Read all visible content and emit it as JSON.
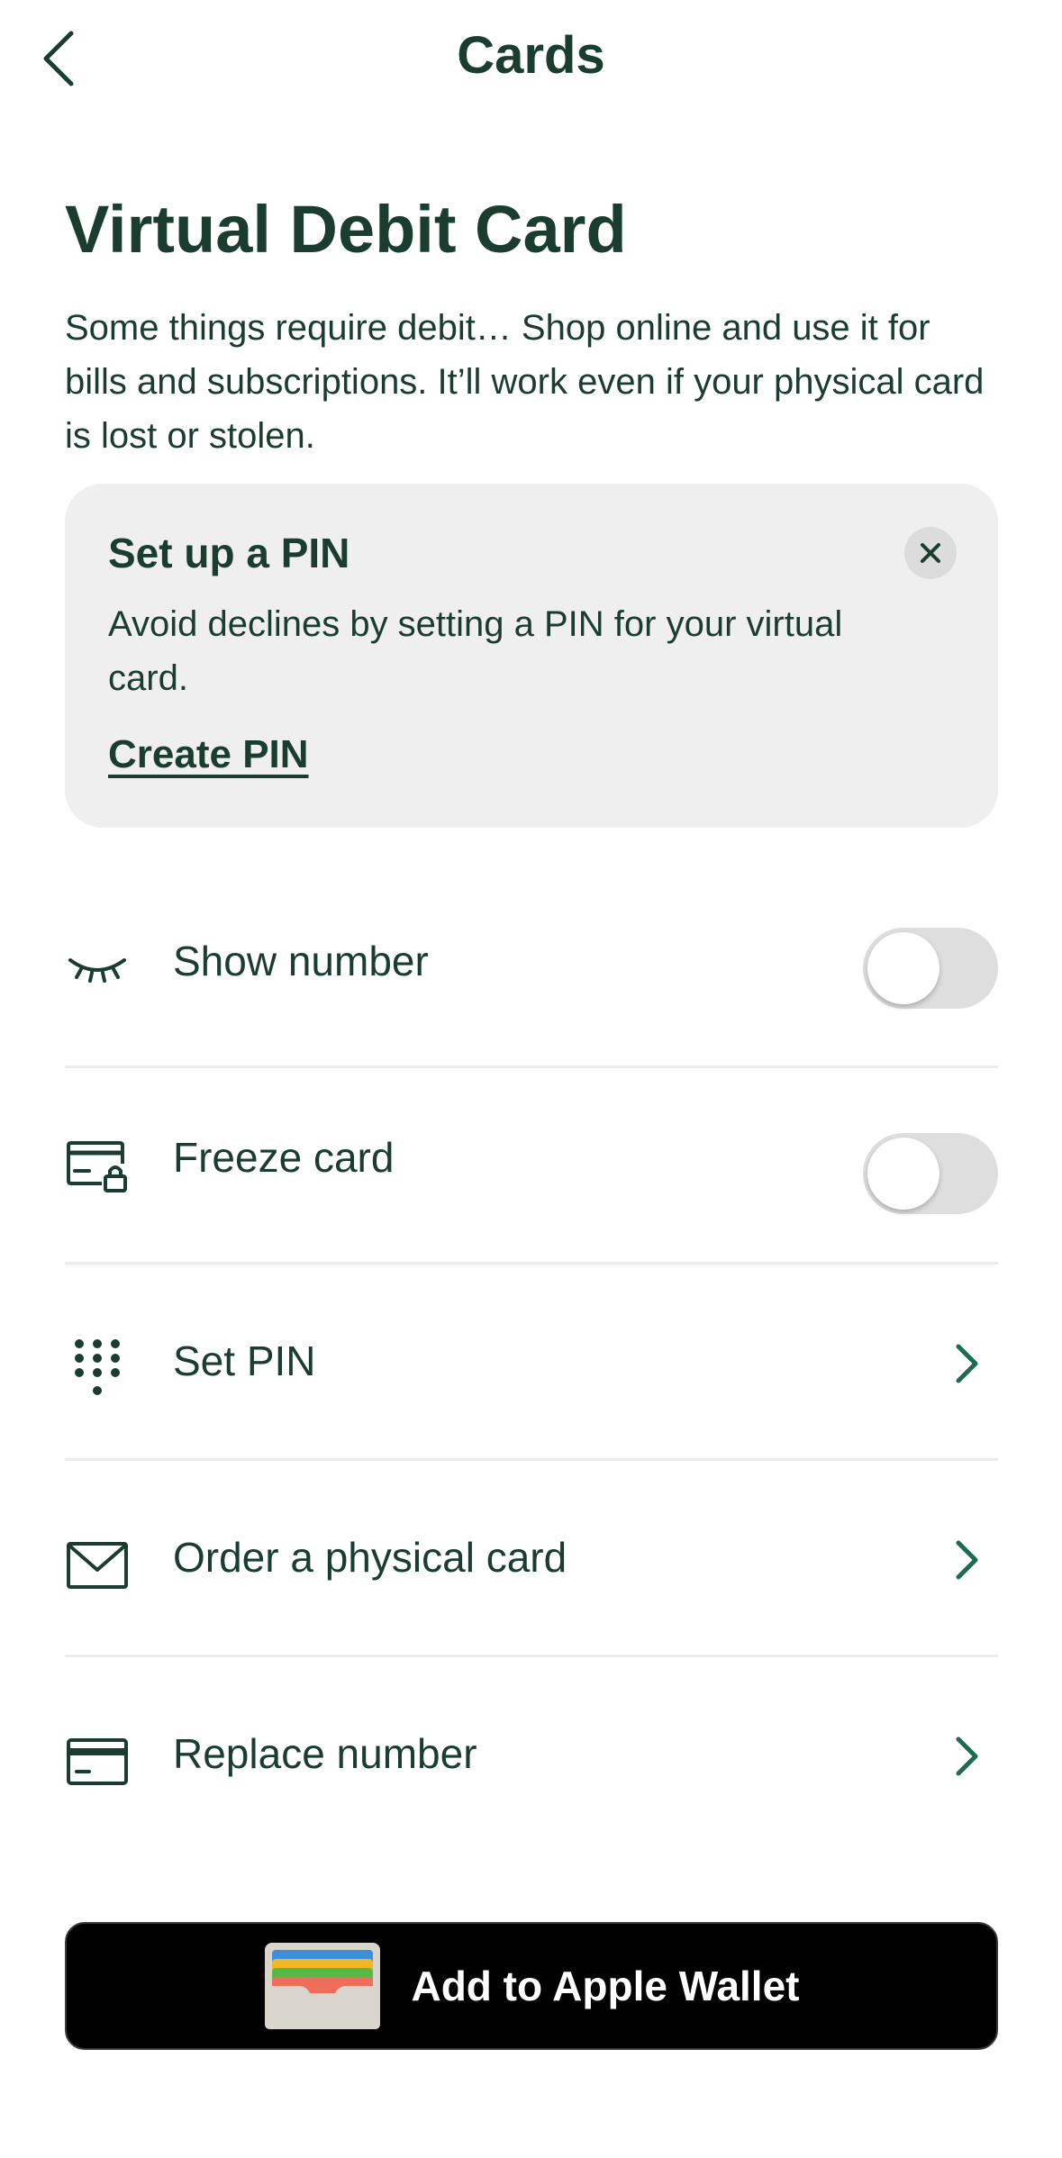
{
  "nav": {
    "title": "Cards",
    "back_icon": "chevron-left-icon"
  },
  "page": {
    "title": "Virtual Debit Card",
    "description": "Some things require debit… Shop online and use it for bills and subscriptions. It’ll work even if your physical card is lost or stolen."
  },
  "pin_banner": {
    "title": "Set up a PIN",
    "body": "Avoid declines by setting a PIN for your virtual card.",
    "link_label": "Create PIN",
    "close_icon": "close-icon"
  },
  "settings": [
    {
      "label": "Show number",
      "icon": "eye-closed-icon",
      "control": "toggle",
      "on": false
    },
    {
      "label": "Freeze card",
      "icon": "card-lock-icon",
      "control": "toggle",
      "on": false
    },
    {
      "label": "Set PIN",
      "icon": "keypad-icon",
      "control": "chevron"
    },
    {
      "label": "Order a physical card",
      "icon": "envelope-icon",
      "control": "chevron"
    },
    {
      "label": "Replace number",
      "icon": "credit-card-icon",
      "control": "chevron"
    }
  ],
  "wallet_button": {
    "label": "Add to Apple Wallet",
    "icon": "wallet-icon"
  },
  "colors": {
    "primary_text": "#1b3d2f",
    "chevron": "#1f6b52",
    "banner_bg": "#efefef",
    "toggle_off": "#dedede",
    "button_bg": "#000000"
  }
}
